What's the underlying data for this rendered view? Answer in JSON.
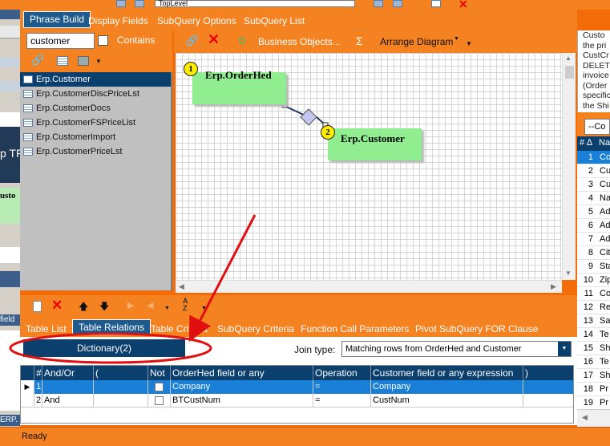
{
  "top": {
    "dropdown_value": "TopLevel"
  },
  "main_tabs": [
    {
      "label": "Phrase Build",
      "active": true
    },
    {
      "label": "Display Fields"
    },
    {
      "label": "SubQuery Options"
    },
    {
      "label": "SubQuery List"
    }
  ],
  "search": {
    "value": "customer",
    "contains_label": "Contains"
  },
  "table_list": [
    "Erp.Customer",
    "Erp.CustomerDiscPriceLst",
    "Erp.CustomerDocs",
    "Erp.CustomerFSPriceList",
    "Erp.CustomerImport",
    "Erp.CustomerPriceLst"
  ],
  "diagram_toolbar": {
    "business_objects": "Business Objects...",
    "sigma": "Σ",
    "arrange": "Arrange Diagram"
  },
  "diagram": {
    "table1": {
      "num": "1",
      "name": "Erp.OrderHed"
    },
    "table2": {
      "num": "2",
      "name": "Erp.Customer"
    }
  },
  "bottom_tabs": [
    {
      "label": "Table List"
    },
    {
      "label": "Table Relations",
      "active": true
    },
    {
      "label": "Table Criteria"
    },
    {
      "label": "SubQuery Criteria"
    },
    {
      "label": "Function Call Parameters"
    },
    {
      "label": "Pivot SubQuery FOR Clause"
    }
  ],
  "relations": {
    "dictionary_button": "Dictionary(2)",
    "join_type_label": "Join type:",
    "join_type_value": "Matching rows from OrderHed and Customer",
    "columns": [
      "#",
      "And/Or",
      "(",
      "Not",
      "OrderHed field or any expression",
      "Operation",
      "Customer field or any expression",
      ")"
    ],
    "rows": [
      {
        "num": "1",
        "andor": "",
        "paren_open": "",
        "not": false,
        "left": "Company",
        "op": "=",
        "right": "Company",
        "paren_close": ""
      },
      {
        "num": "2",
        "andor": "And",
        "paren_open": "",
        "not": false,
        "left": "BTCustNum",
        "op": "=",
        "right": "CustNum",
        "paren_close": ""
      }
    ]
  },
  "status": {
    "text": "Ready"
  },
  "right_panel": {
    "description_lines": [
      "Custo",
      "the pri",
      "CustCr",
      "DELETI",
      "invoice",
      "(Order",
      "specific",
      "the Shi"
    ],
    "combo_value": "--Co",
    "header_num": "# ∆",
    "header_name": "Na",
    "rows": [
      {
        "n": "1",
        "name": "Co"
      },
      {
        "n": "2",
        "name": "Cu"
      },
      {
        "n": "3",
        "name": "Cu"
      },
      {
        "n": "4",
        "name": "Na"
      },
      {
        "n": "5",
        "name": "Ad"
      },
      {
        "n": "6",
        "name": "Ad"
      },
      {
        "n": "7",
        "name": "Ad"
      },
      {
        "n": "8",
        "name": "Cit"
      },
      {
        "n": "9",
        "name": "Sta"
      },
      {
        "n": "10",
        "name": "Zip"
      },
      {
        "n": "11",
        "name": "Co"
      },
      {
        "n": "12",
        "name": "Re"
      },
      {
        "n": "13",
        "name": "Sa"
      },
      {
        "n": "14",
        "name": "Te"
      },
      {
        "n": "15",
        "name": "Sh"
      },
      {
        "n": "16",
        "name": "Te"
      },
      {
        "n": "17",
        "name": "Sh"
      },
      {
        "n": "18",
        "name": "Pr"
      },
      {
        "n": "19",
        "name": "Pr"
      }
    ]
  },
  "left_strip": {
    "text1": "p TF",
    "text2": "usto",
    "text3": "field",
    "text4": "ERP."
  }
}
